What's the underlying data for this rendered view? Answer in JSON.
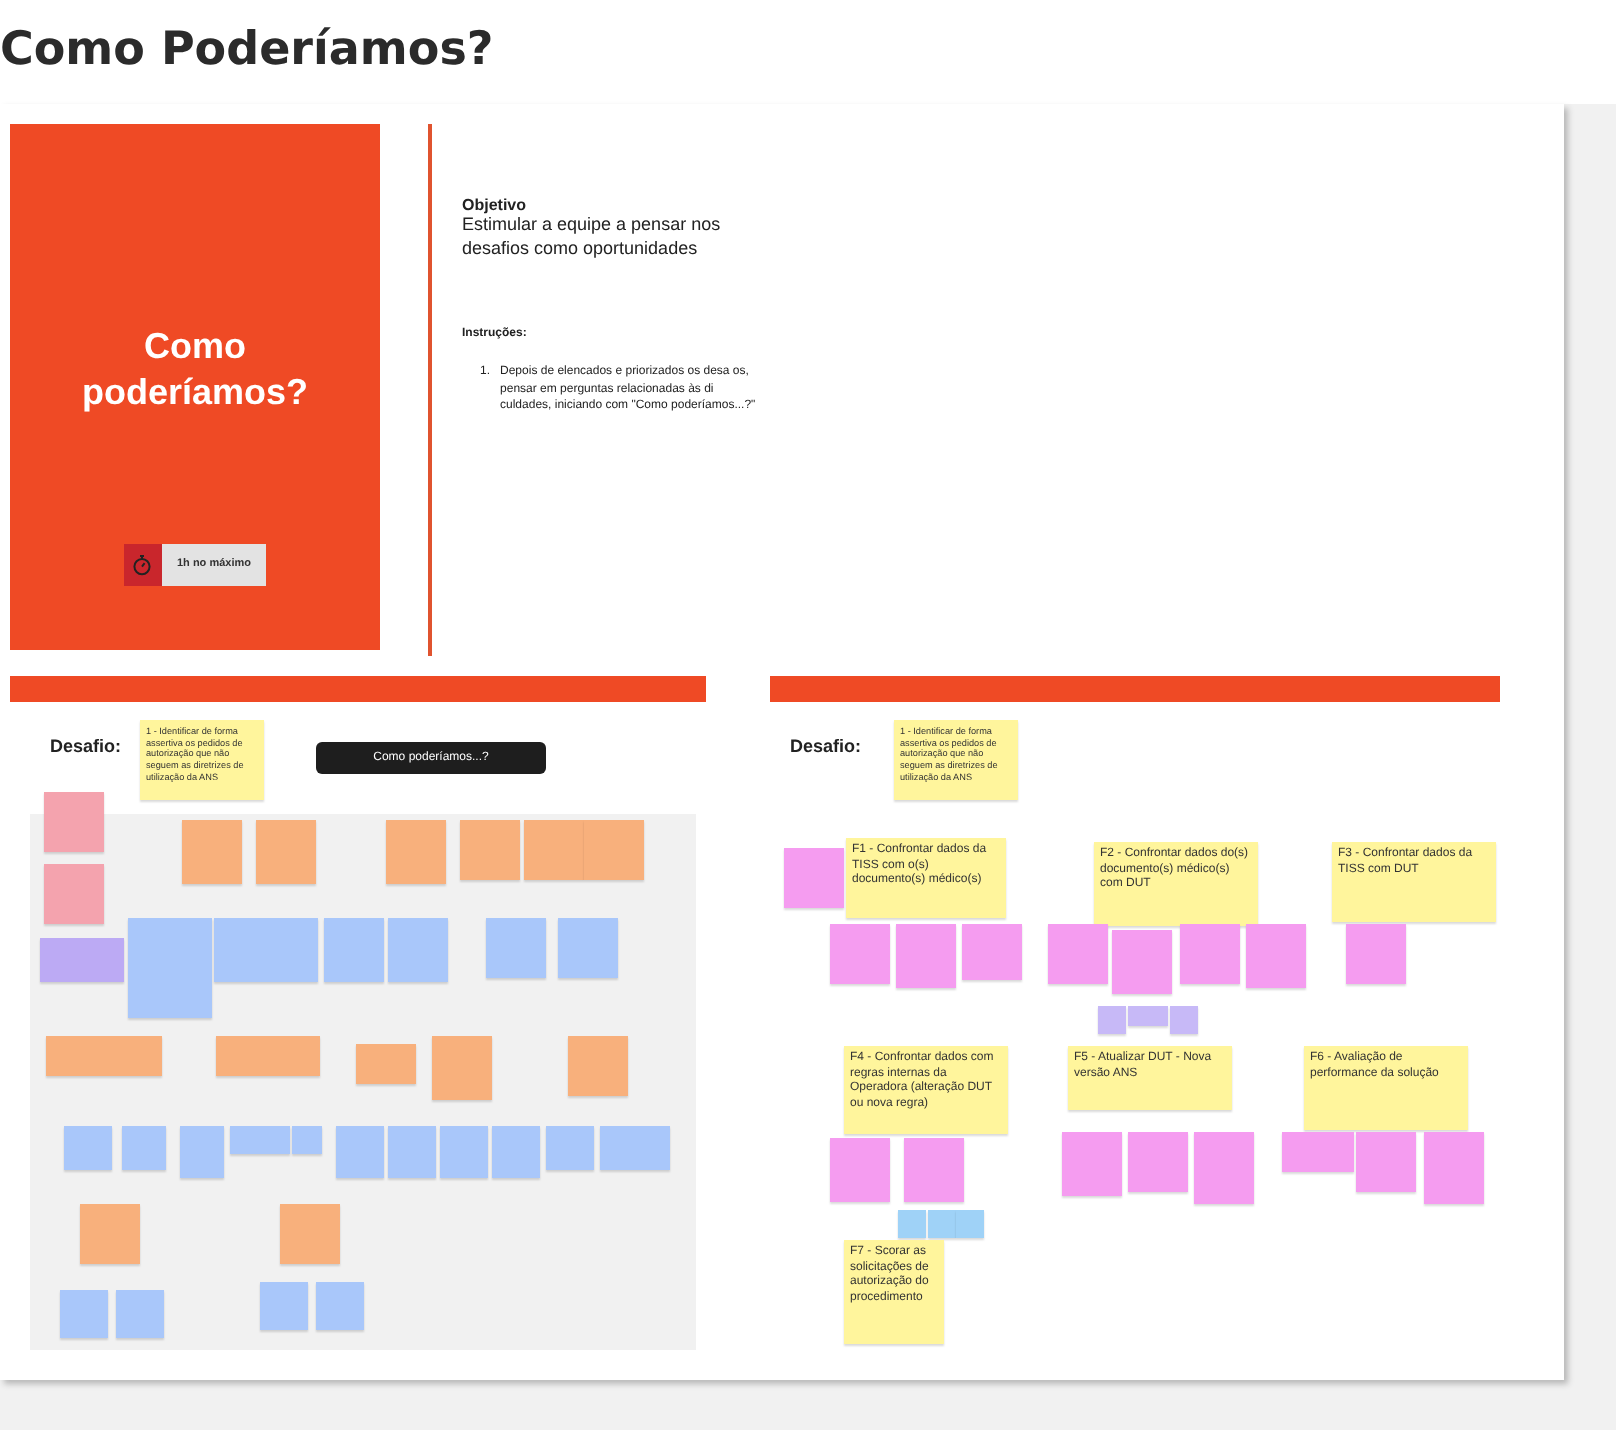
{
  "page_title": "Como Poderíamos?",
  "intro_card": {
    "title": "Como poderíamos?",
    "timer_label": "1h no máximo"
  },
  "objective": {
    "heading": "Objetivo",
    "text": "Estimular a equipe a pensar nos desafios como oportunidades"
  },
  "instructions": {
    "heading": "Instruções:",
    "items": [
      {
        "number": "1.",
        "text": "Depois de elencados e priorizados os desa os, pensar em perguntas relacionadas às di culdades, iniciando com \"Como poderíamos...?\""
      }
    ]
  },
  "boards": [
    {
      "label": "Desafio:",
      "challenge": "1 - Identificar de forma assertiva os pedidos de autorização que não seguem as diretrizes de utilização da ANS",
      "prompt": "Como poderíamos...?",
      "notes": [
        {
          "color": "#f4a3ae"
        },
        {
          "color": "#f4a3ae"
        },
        {
          "color": "#bcaaf4"
        },
        {
          "color": "#f8b07c"
        },
        {
          "color": "#f8b07c"
        },
        {
          "color": "#f8b07c"
        },
        {
          "color": "#f8b07c"
        },
        {
          "color": "#f8b07c"
        },
        {
          "color": "#f8b07c"
        },
        {
          "color": "#a9c7fa"
        },
        {
          "color": "#a9c7fa"
        },
        {
          "color": "#a9c7fa"
        },
        {
          "color": "#a9c7fa"
        },
        {
          "color": "#a9c7fa"
        },
        {
          "color": "#a9c7fa"
        },
        {
          "color": "#f8b07c"
        },
        {
          "color": "#f8b07c"
        },
        {
          "color": "#f8b07c"
        },
        {
          "color": "#f8b07c"
        },
        {
          "color": "#f8b07c"
        },
        {
          "color": "#a9c7fa"
        },
        {
          "color": "#a9c7fa"
        },
        {
          "color": "#a9c7fa"
        },
        {
          "color": "#a9c7fa"
        },
        {
          "color": "#a9c7fa"
        },
        {
          "color": "#a9c7fa"
        },
        {
          "color": "#a9c7fa"
        },
        {
          "color": "#a9c7fa"
        },
        {
          "color": "#a9c7fa"
        },
        {
          "color": "#a9c7fa"
        },
        {
          "color": "#a9c7fa"
        },
        {
          "color": "#f8b07c"
        },
        {
          "color": "#f8b07c"
        },
        {
          "color": "#a9c7fa"
        },
        {
          "color": "#a9c7fa"
        },
        {
          "color": "#a9c7fa"
        },
        {
          "color": "#a9c7fa"
        }
      ]
    },
    {
      "label": "Desafio:",
      "challenge": "1 - Identificar de forma assertiva os pedidos de autorização que não seguem as diretrizes de utilização da ANS",
      "notes": [
        {
          "color": "#fff59c",
          "text": "F1 - Confrontar dados da TISS com o(s) documento(s) médico(s)"
        },
        {
          "color": "#f59cf0"
        },
        {
          "color": "#f59cf0"
        },
        {
          "color": "#f59cf0"
        },
        {
          "color": "#f59cf0"
        },
        {
          "color": "#fff59c",
          "text": "F2 - Confrontar dados do(s) documento(s) médico(s) com DUT"
        },
        {
          "color": "#f59cf0"
        },
        {
          "color": "#f59cf0"
        },
        {
          "color": "#f59cf0"
        },
        {
          "color": "#f59cf0"
        },
        {
          "color": "#c7b9f7"
        },
        {
          "color": "#c7b9f7"
        },
        {
          "color": "#c7b9f7"
        },
        {
          "color": "#fff59c",
          "text": "F3 - Confrontar dados da TISS com DUT"
        },
        {
          "color": "#f59cf0"
        },
        {
          "color": "#fff59c",
          "text": "F4 - Confrontar dados com regras internas da Operadora (alteração DUT ou nova regra)"
        },
        {
          "color": "#f59cf0"
        },
        {
          "color": "#f59cf0"
        },
        {
          "color": "#9fd2f7"
        },
        {
          "color": "#9fd2f7"
        },
        {
          "color": "#9fd2f7"
        },
        {
          "color": "#fff59c",
          "text": "F7 - Scorar as solicitações de autorização do procedimento"
        },
        {
          "color": "#fff59c",
          "text": "F5 - Atualizar DUT - Nova versão ANS"
        },
        {
          "color": "#f59cf0"
        },
        {
          "color": "#f59cf0"
        },
        {
          "color": "#f59cf0"
        },
        {
          "color": "#fff59c",
          "text": "F6 - Avaliação de performance da solução"
        },
        {
          "color": "#f59cf0"
        },
        {
          "color": "#f59cf0"
        },
        {
          "color": "#f59cf0"
        }
      ]
    }
  ]
}
